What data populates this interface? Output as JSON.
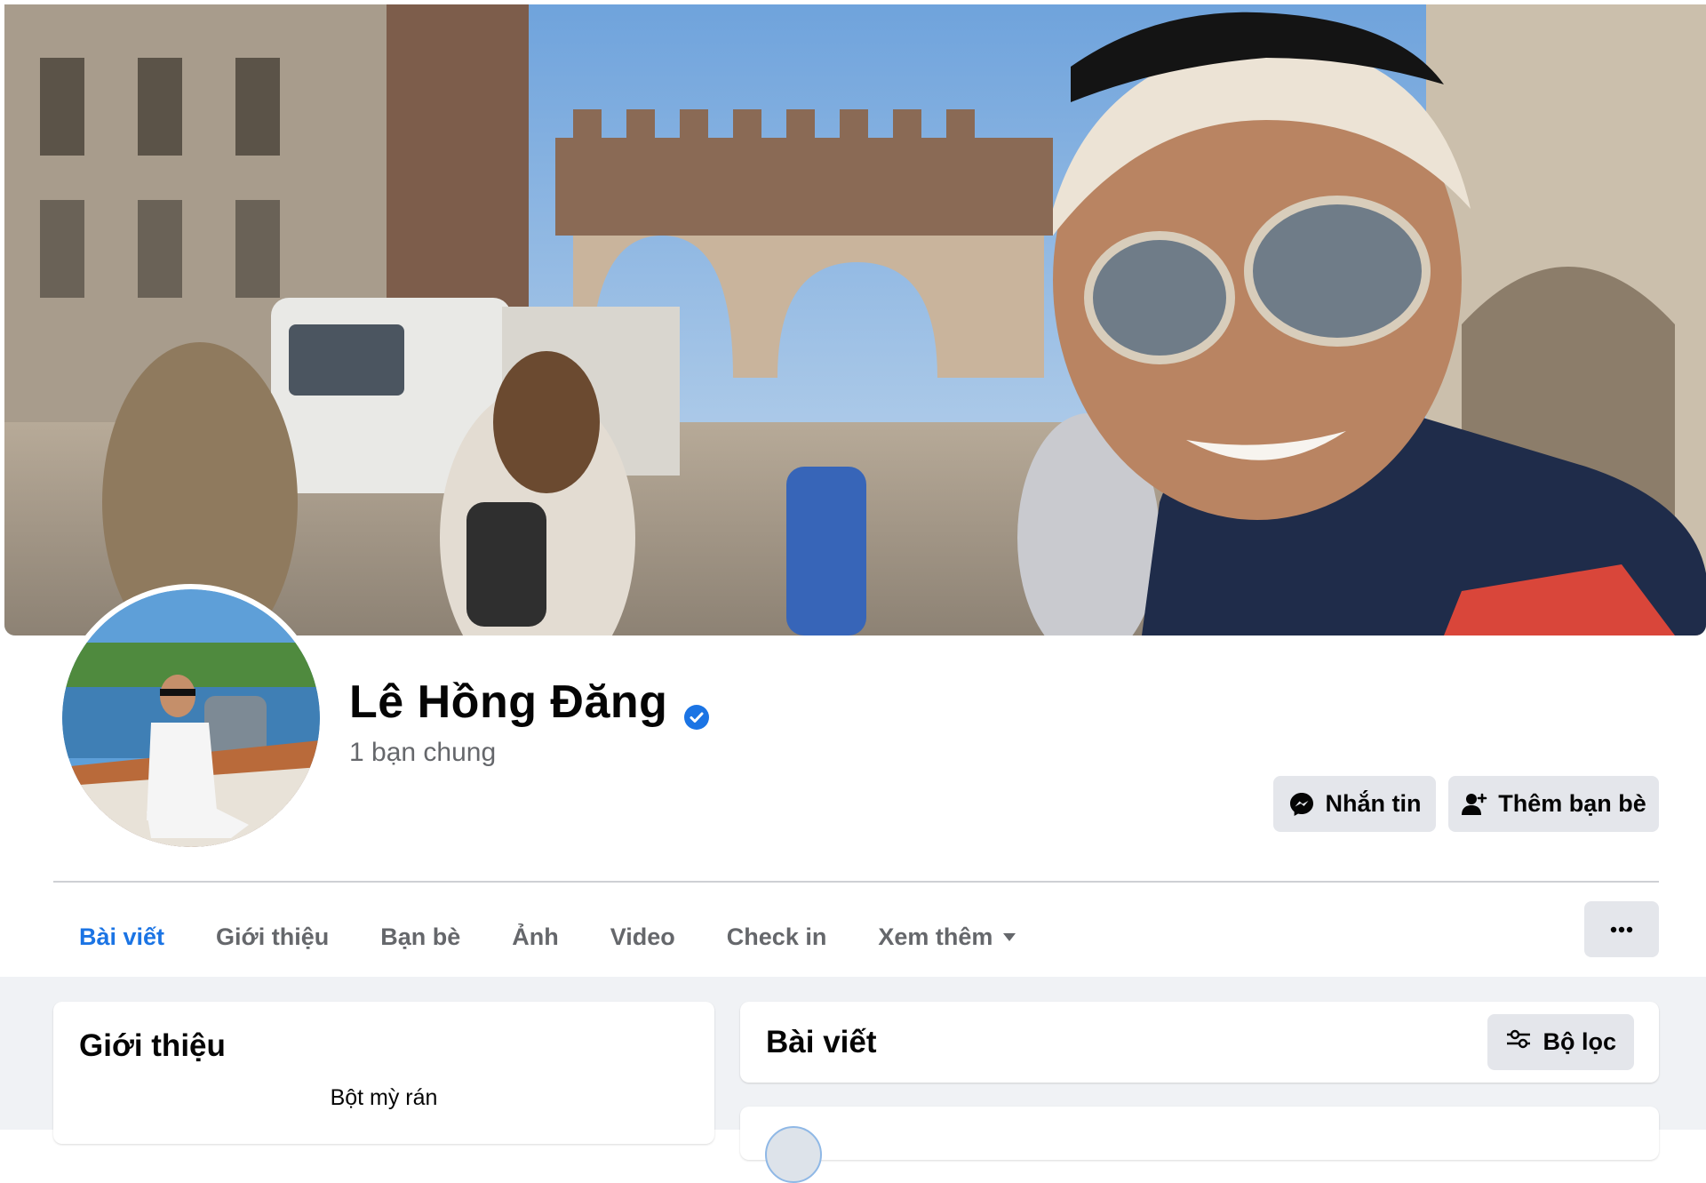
{
  "profile": {
    "name": "Lê Hồng Đăng",
    "mutual_friends": "1 bạn chung",
    "verified": true
  },
  "actions": {
    "message_label": "Nhắn tin",
    "add_friend_label": "Thêm bạn bè"
  },
  "tabs": [
    {
      "label": "Bài viết",
      "active": true
    },
    {
      "label": "Giới thiệu",
      "active": false
    },
    {
      "label": "Bạn bè",
      "active": false
    },
    {
      "label": "Ảnh",
      "active": false
    },
    {
      "label": "Video",
      "active": false
    },
    {
      "label": "Check in",
      "active": false
    },
    {
      "label": "Xem thêm",
      "active": false,
      "dropdown": true
    }
  ],
  "intro": {
    "title": "Giới thiệu",
    "bio": "Bột mỳ rán"
  },
  "posts": {
    "title": "Bài viết",
    "filter_label": "Bộ lọc"
  },
  "icons": {
    "verified": "verified-badge-icon",
    "message": "messenger-icon",
    "add_friend": "add-person-icon",
    "dropdown": "caret-down-icon",
    "more": "more-horizontal-icon",
    "filter": "sliders-icon"
  },
  "colors": {
    "accent": "#1b74e4",
    "button_bg": "#e4e6eb",
    "secondary_text": "#65676b",
    "page_bg": "#f0f2f5"
  }
}
